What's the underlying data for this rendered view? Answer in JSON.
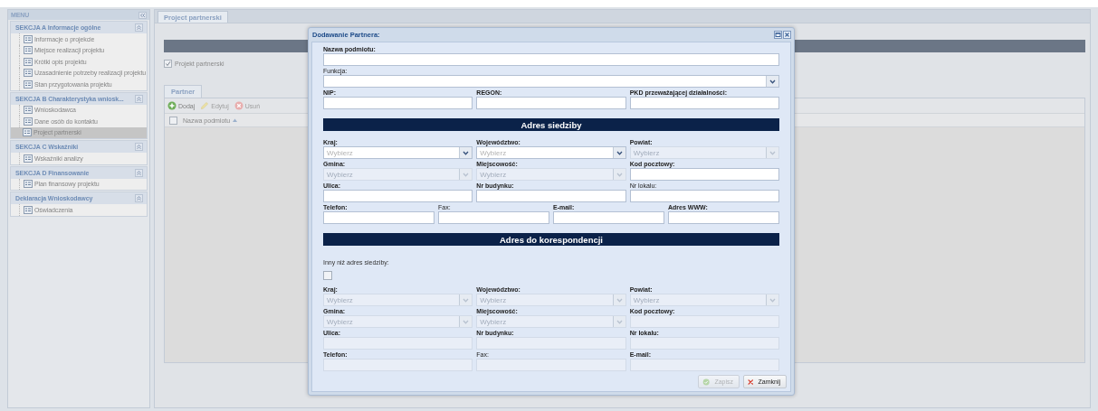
{
  "sidebar": {
    "title": "MENU",
    "sections": [
      {
        "title": "SEKCJA A Informacje ogólne",
        "expanded": true,
        "items": [
          {
            "label": "Informacje o projekcie",
            "selected": false
          },
          {
            "label": "Miejsce realizacji projektu",
            "selected": false
          },
          {
            "label": "Krótki opis projektu",
            "selected": false
          },
          {
            "label": "Uzasadnienie potrzeby realizacji projektu",
            "selected": false
          },
          {
            "label": "Stan przygotowania projektu",
            "selected": false
          }
        ]
      },
      {
        "title": "SEKCJA B Charakterystyka wniosk...",
        "expanded": true,
        "items": [
          {
            "label": "Wnioskodawca",
            "selected": false
          },
          {
            "label": "Dane osób do kontaktu",
            "selected": false
          },
          {
            "label": "Project partnerski",
            "selected": true
          }
        ]
      },
      {
        "title": "SEKCJA C Wskaźniki",
        "expanded": true,
        "items": [
          {
            "label": "Wskaźniki analizy",
            "selected": false
          }
        ]
      },
      {
        "title": "SEKCJA D Finansowanie",
        "expanded": true,
        "items": [
          {
            "label": "Plan finansowy projektu",
            "selected": false
          }
        ]
      },
      {
        "title": "Deklaracja Wnioskodawcy",
        "expanded": true,
        "items": [
          {
            "label": "Oświadczenia",
            "selected": false
          }
        ]
      }
    ]
  },
  "main": {
    "tab": {
      "label": "Project partnerski",
      "selected": true
    },
    "checkbox": {
      "label": "Projekt partnerski",
      "checked": true
    },
    "panel_tab": {
      "label": "Partner",
      "selected": true
    },
    "toolbar": [
      {
        "kind": "add",
        "label": "Dodaj",
        "disabled": false
      },
      {
        "kind": "edit",
        "label": "Edytuj",
        "disabled": true
      },
      {
        "kind": "delete",
        "label": "Usuń",
        "disabled": true
      }
    ],
    "grid": {
      "select_all": false,
      "columns": [
        {
          "label": "Nazwa podmiotu"
        }
      ]
    }
  },
  "dialog": {
    "title": "Dodawanie Partnera:",
    "blocks": [
      {
        "kind": "fields",
        "rows": [
          [
            {
              "label": "Nazwa podmiotu:",
              "required": true,
              "kind": "text",
              "disabled": false
            }
          ],
          [
            {
              "label": "Funkcja:",
              "required": false,
              "kind": "select",
              "disabled": false
            }
          ],
          [
            {
              "label": "NIP:",
              "required": true,
              "kind": "text",
              "disabled": false
            },
            {
              "label": "REGON:",
              "required": true,
              "kind": "text",
              "disabled": false
            },
            {
              "label": "PKD przeważającej działalności:",
              "required": true,
              "kind": "text",
              "disabled": false
            }
          ]
        ]
      },
      {
        "kind": "header",
        "title": "Adres siedziby"
      },
      {
        "kind": "fields",
        "rows": [
          [
            {
              "label": "Kraj:",
              "required": true,
              "kind": "select",
              "placeholder": "Wybierz",
              "disabled": false
            },
            {
              "label": "Województwo:",
              "required": true,
              "kind": "select",
              "placeholder": "Wybierz",
              "disabled": false
            },
            {
              "label": "Powiat:",
              "required": true,
              "kind": "select",
              "placeholder": "Wybierz",
              "disabled": true
            }
          ],
          [
            {
              "label": "Gmina:",
              "required": true,
              "kind": "select",
              "placeholder": "Wybierz",
              "disabled": true
            },
            {
              "label": "Miejscowość:",
              "required": true,
              "kind": "select",
              "placeholder": "Wybierz",
              "disabled": true
            },
            {
              "label": "Kod pocztowy:",
              "required": true,
              "kind": "text",
              "disabled": false
            }
          ],
          [
            {
              "label": "Ulica:",
              "required": true,
              "kind": "text",
              "disabled": false
            },
            {
              "label": "Nr budynku:",
              "required": true,
              "kind": "text",
              "disabled": false
            },
            {
              "label": "Nr lokalu:",
              "required": false,
              "kind": "text",
              "disabled": false
            }
          ],
          [
            {
              "label": "Telefon:",
              "required": true,
              "kind": "text",
              "disabled": false
            },
            {
              "label": "Fax:",
              "required": false,
              "kind": "text",
              "disabled": false
            },
            {
              "label": "E-mail:",
              "required": true,
              "kind": "text",
              "disabled": false
            },
            {
              "label": "Adres WWW:",
              "required": true,
              "kind": "text",
              "disabled": false
            }
          ]
        ]
      },
      {
        "kind": "header",
        "title": "Adres do korespondencji"
      },
      {
        "kind": "note",
        "text": "Inny niż adres siedziby:"
      },
      {
        "kind": "checkbox",
        "checked": false
      },
      {
        "kind": "fields",
        "rows": [
          [
            {
              "label": "Kraj:",
              "required": true,
              "kind": "select",
              "placeholder": "Wybierz",
              "disabled": true
            },
            {
              "label": "Województwo:",
              "required": true,
              "kind": "select",
              "placeholder": "Wybierz",
              "disabled": true
            },
            {
              "label": "Powiat:",
              "required": true,
              "kind": "select",
              "placeholder": "Wybierz",
              "disabled": true
            }
          ],
          [
            {
              "label": "Gmina:",
              "required": true,
              "kind": "select",
              "placeholder": "Wybierz",
              "disabled": true
            },
            {
              "label": "Miejscowość:",
              "required": true,
              "kind": "select",
              "placeholder": "Wybierz",
              "disabled": true
            },
            {
              "label": "Kod pocztowy:",
              "required": true,
              "kind": "text",
              "disabled": true
            }
          ],
          [
            {
              "label": "Ulica:",
              "required": true,
              "kind": "text",
              "disabled": true
            },
            {
              "label": "Nr budynku:",
              "required": true,
              "kind": "text",
              "disabled": true
            },
            {
              "label": "Nr lokalu:",
              "required": true,
              "kind": "text",
              "disabled": true
            }
          ],
          [
            {
              "label": "Telefon:",
              "required": true,
              "kind": "text",
              "disabled": true
            },
            {
              "label": "Fax:",
              "required": false,
              "kind": "text",
              "disabled": true
            },
            {
              "label": "E-mail:",
              "required": true,
              "kind": "text",
              "disabled": true
            }
          ]
        ]
      }
    ],
    "buttons": [
      {
        "kind": "save",
        "label": "Zapisz",
        "disabled": true
      },
      {
        "kind": "close",
        "label": "Zamknij",
        "disabled": false
      }
    ]
  }
}
